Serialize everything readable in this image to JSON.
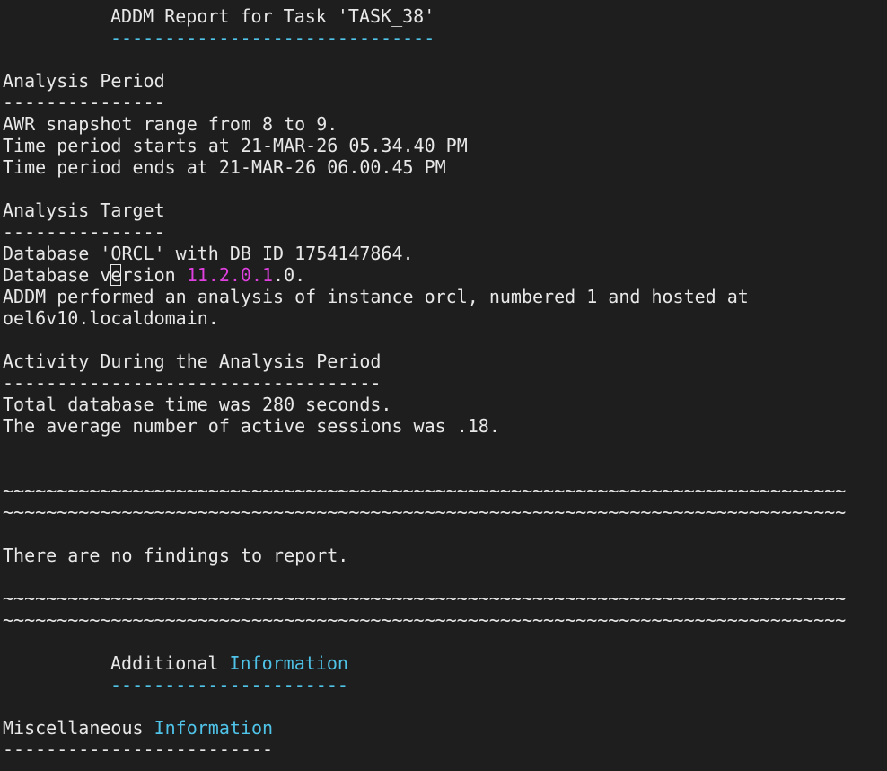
{
  "report": {
    "title": "ADDM Report for Task 'TASK_38'",
    "title_rule": "------------------------------",
    "period": {
      "heading": "Analysis Period",
      "rule": "---------------",
      "lines": [
        "AWR snapshot range from 8 to 9.",
        "Time period starts at 21-MAR-26 05.34.40 PM",
        "Time period ends at 21-MAR-26 06.00.45 PM"
      ]
    },
    "target": {
      "heading": "Analysis Target",
      "rule": "---------------",
      "db_line": "Database 'ORCL' with DB ID 1754147864.",
      "version_prefix": "Database v",
      "version_cursor_char": "e",
      "version_mid": "rsion ",
      "version_number": "11.2.0.1",
      "version_suffix": ".0.",
      "instance_line": "ADDM performed an analysis of instance orcl, numbered 1 and hosted at",
      "host_line": "oel6v10.localdomain."
    },
    "activity": {
      "heading": "Activity During the Analysis Period",
      "rule": "-----------------------------------",
      "lines": [
        "Total database time was 280 seconds.",
        "The average number of active sessions was .18."
      ]
    },
    "tilde_rule": "~~~~~~~~~~~~~~~~~~~~~~~~~~~~~~~~~~~~~~~~~~~~~~~~~~~~~~~~~~~~~~~~~~~~~~~~~~~~~~",
    "findings": "There are no findings to report.",
    "additional": {
      "word": "Additional",
      "info_word": "Information",
      "rule": "----------------------"
    },
    "misc": {
      "word": "Miscellaneous",
      "info_word": "Information",
      "rule": "-------------------------"
    }
  }
}
